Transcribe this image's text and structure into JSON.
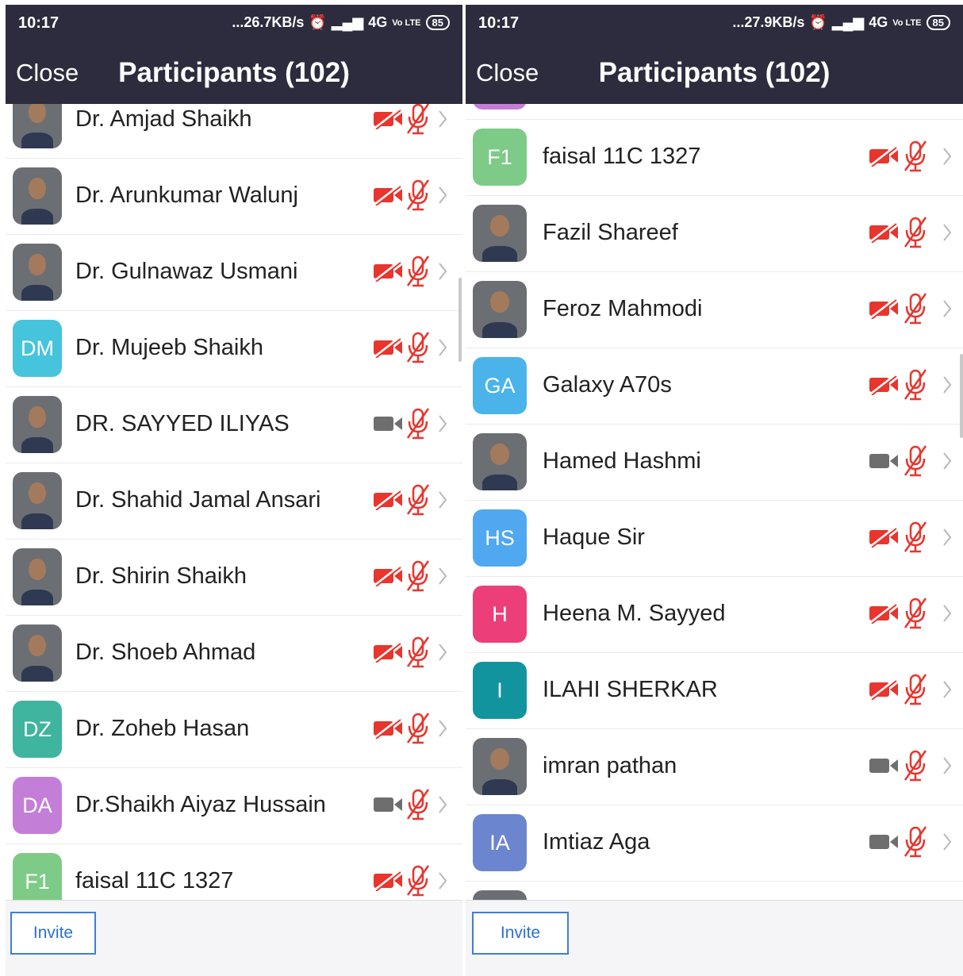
{
  "left": {
    "status": {
      "time": "10:17",
      "speed": "...26.7KB/s",
      "network": "4G",
      "volte": "Vo LTE",
      "battery": "85"
    },
    "header": {
      "close_label": "Close",
      "title": "Participants (102)"
    },
    "footer": {
      "invite_label": "Invite"
    },
    "participants": [
      {
        "name": "Dr. Amjad Shaikh",
        "avatar": {
          "type": "photo"
        },
        "video": "off",
        "audio": "muted"
      },
      {
        "name": "Dr. Arunkumar Walunj",
        "avatar": {
          "type": "photo"
        },
        "video": "off",
        "audio": "muted"
      },
      {
        "name": "Dr. Gulnawaz Usmani",
        "avatar": {
          "type": "photo"
        },
        "video": "off",
        "audio": "muted"
      },
      {
        "name": "Dr. Mujeeb Shaikh",
        "avatar": {
          "type": "initials",
          "initials": "DM",
          "color": "#46c4dc"
        },
        "video": "off",
        "audio": "muted"
      },
      {
        "name": "DR. SAYYED ILIYAS",
        "avatar": {
          "type": "photo"
        },
        "video": "on",
        "audio": "muted"
      },
      {
        "name": "Dr. Shahid Jamal Ansari",
        "avatar": {
          "type": "photo"
        },
        "video": "off",
        "audio": "muted"
      },
      {
        "name": "Dr. Shirin Shaikh",
        "avatar": {
          "type": "photo"
        },
        "video": "off",
        "audio": "muted"
      },
      {
        "name": "Dr. Shoeb Ahmad",
        "avatar": {
          "type": "photo"
        },
        "video": "off",
        "audio": "muted"
      },
      {
        "name": "Dr. Zoheb Hasan",
        "avatar": {
          "type": "initials",
          "initials": "DZ",
          "color": "#3fb49e"
        },
        "video": "off",
        "audio": "muted"
      },
      {
        "name": "Dr.Shaikh Aiyaz Hussain",
        "avatar": {
          "type": "initials",
          "initials": "DA",
          "color": "#c37fd8"
        },
        "video": "on",
        "audio": "muted"
      },
      {
        "name": "faisal 11C 1327",
        "avatar": {
          "type": "initials",
          "initials": "F1",
          "color": "#7ecb87"
        },
        "video": "off",
        "audio": "muted"
      }
    ]
  },
  "right": {
    "status": {
      "time": "10:17",
      "speed": "...27.9KB/s",
      "network": "4G",
      "volte": "Vo LTE",
      "battery": "85"
    },
    "header": {
      "close_label": "Close",
      "title": "Participants (102)"
    },
    "footer": {
      "invite_label": "Invite"
    },
    "participants": [
      {
        "name": "",
        "avatar": {
          "type": "initials",
          "initials": "",
          "color": "#c37fd8"
        },
        "video": "off",
        "audio": "muted"
      },
      {
        "name": "faisal 11C 1327",
        "avatar": {
          "type": "initials",
          "initials": "F1",
          "color": "#7ecb87"
        },
        "video": "off",
        "audio": "muted"
      },
      {
        "name": "Fazil Shareef",
        "avatar": {
          "type": "photo"
        },
        "video": "off",
        "audio": "muted"
      },
      {
        "name": "Feroz Mahmodi",
        "avatar": {
          "type": "photo"
        },
        "video": "off",
        "audio": "muted"
      },
      {
        "name": "Galaxy A70s",
        "avatar": {
          "type": "initials",
          "initials": "GA",
          "color": "#4ab3ea"
        },
        "video": "off",
        "audio": "muted"
      },
      {
        "name": "Hamed Hashmi",
        "avatar": {
          "type": "photo"
        },
        "video": "on",
        "audio": "muted"
      },
      {
        "name": "Haque Sir",
        "avatar": {
          "type": "initials",
          "initials": "HS",
          "color": "#4fa8f0"
        },
        "video": "off",
        "audio": "muted"
      },
      {
        "name": "Heena M. Sayyed",
        "avatar": {
          "type": "initials",
          "initials": "H",
          "color": "#ec3f79"
        },
        "video": "off",
        "audio": "muted"
      },
      {
        "name": "ILAHI SHERKAR",
        "avatar": {
          "type": "initials",
          "initials": "I",
          "color": "#12949f"
        },
        "video": "off",
        "audio": "muted"
      },
      {
        "name": "imran pathan",
        "avatar": {
          "type": "photo"
        },
        "video": "on",
        "audio": "muted"
      },
      {
        "name": "Imtiaz Aga",
        "avatar": {
          "type": "initials",
          "initials": "IA",
          "color": "#6c85cf"
        },
        "video": "on",
        "audio": "muted"
      },
      {
        "name": "",
        "avatar": {
          "type": "photo"
        },
        "video": "on",
        "audio": "muted"
      }
    ]
  }
}
